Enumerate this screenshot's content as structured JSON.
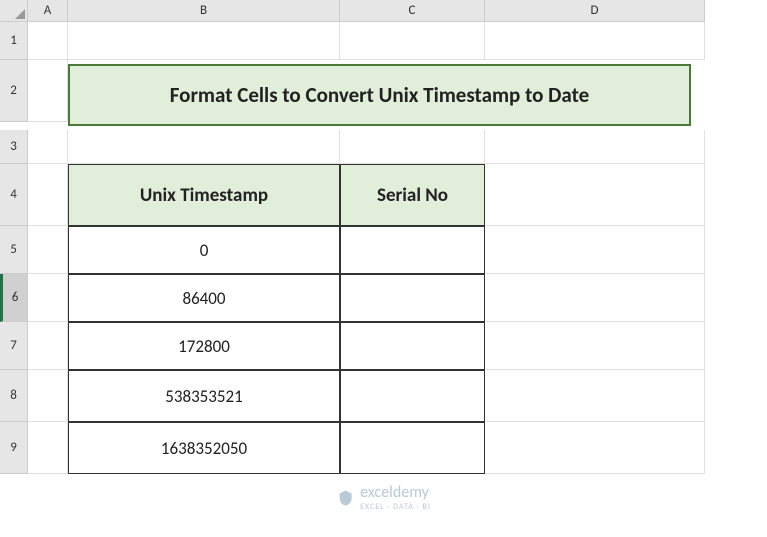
{
  "columns": [
    "A",
    "B",
    "C",
    "D"
  ],
  "rows": [
    "1",
    "2",
    "3",
    "4",
    "5",
    "6",
    "7",
    "8",
    "9"
  ],
  "selected_row": "6",
  "title": "Format Cells to Convert Unix Timestamp to Date",
  "chart_data": {
    "type": "table",
    "title": "Format Cells to Convert Unix Timestamp to Date",
    "columns": [
      "Unix Timestamp",
      "Serial No"
    ],
    "rows": [
      {
        "unix_timestamp": 0,
        "serial_no": ""
      },
      {
        "unix_timestamp": 86400,
        "serial_no": ""
      },
      {
        "unix_timestamp": 172800,
        "serial_no": ""
      },
      {
        "unix_timestamp": 538353521,
        "serial_no": ""
      },
      {
        "unix_timestamp": 1638352050,
        "serial_no": ""
      }
    ]
  },
  "watermark": {
    "brand": "exceldemy",
    "tagline": "EXCEL · DATA · BI"
  }
}
